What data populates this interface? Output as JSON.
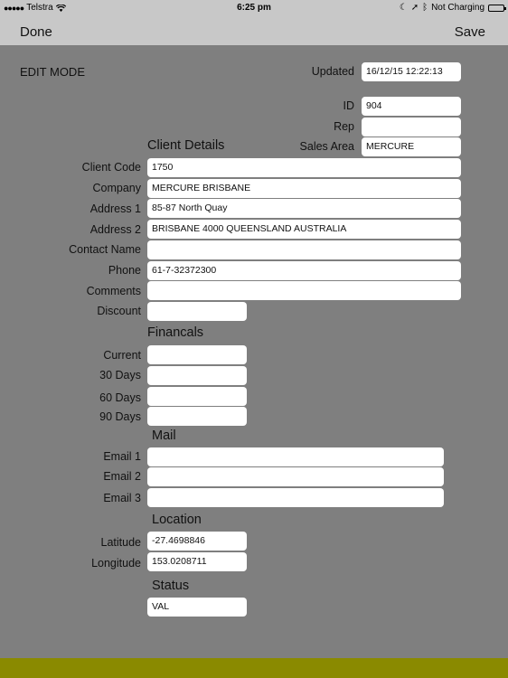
{
  "status_bar": {
    "carrier": "Telstra",
    "time": "6:25 pm",
    "charging": "Not Charging"
  },
  "nav": {
    "done_label": "Done",
    "save_label": "Save"
  },
  "mode_label": "EDIT MODE",
  "header_fields": {
    "updated_label": "Updated",
    "updated_value": "16/12/15 12:22:13",
    "id_label": "ID",
    "id_value": "904",
    "rep_label": "Rep",
    "rep_value": "",
    "sales_area_label": "Sales Area",
    "sales_area_value": "MERCURE"
  },
  "sections": {
    "client_details": "Client Details",
    "financials": "Financals",
    "mail": "Mail",
    "location": "Location",
    "status": "Status"
  },
  "client": {
    "client_code_label": "Client Code",
    "client_code_value": "1750",
    "company_label": "Company",
    "company_value": "MERCURE BRISBANE",
    "address1_label": "Address 1",
    "address1_value": "85-87 North Quay",
    "address2_label": "Address 2",
    "address2_value": "BRISBANE 4000 QUEENSLAND AUSTRALIA",
    "contact_label": "Contact Name",
    "contact_value": "",
    "phone_label": "Phone",
    "phone_value": "61-7-32372300",
    "comments_label": "Comments",
    "comments_value": "",
    "discount_label": "Discount",
    "discount_value": ""
  },
  "financials": {
    "current_label": "Current",
    "current_value": "",
    "d30_label": "30 Days",
    "d30_value": "",
    "d60_label": "60 Days",
    "d60_value": "",
    "d90_label": "90 Days",
    "d90_value": ""
  },
  "mail": {
    "email1_label": "Email 1",
    "email1_value": "",
    "email2_label": "Email 2",
    "email2_value": "",
    "email3_label": "Email 3",
    "email3_value": ""
  },
  "location": {
    "latitude_label": "Latitude",
    "latitude_value": "-27.4698846",
    "longitude_label": "Longitude",
    "longitude_value": "153.0208711"
  },
  "status": {
    "value": "VAL"
  },
  "colors": {
    "background": "#7f7f7f",
    "bar": "#c8c8c8",
    "bottom_bar": "#8a8a00"
  }
}
